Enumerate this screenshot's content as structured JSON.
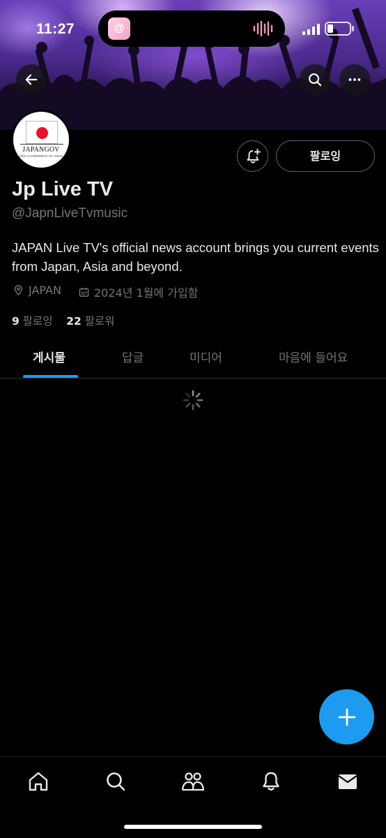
{
  "status_bar": {
    "time": "11:27",
    "island_app_glyph": "@",
    "island_app_color": "#f5a3c8",
    "battery_level": 0.25
  },
  "header": {
    "back_icon": "arrow-left-icon",
    "search_icon": "search-icon",
    "more_icon": "more-horizontal-icon"
  },
  "profile": {
    "avatar_title": "JAPANGOV",
    "avatar_subtitle": "THE GOVERNMENT OF JAPAN",
    "display_name": "Jp Live TV",
    "handle": "@JapnLiveTvmusic",
    "bio": "JAPAN Live TV's official news account brings you current events from Japan, Asia and beyond.",
    "location": "JAPAN",
    "joined": "2024년 1월에 가입함",
    "following_count": "9",
    "following_label": "팔로잉",
    "followers_count": "22",
    "followers_label": "팔로워"
  },
  "actions": {
    "notify_icon": "bell-plus-icon",
    "follow_label": "팔로잉"
  },
  "tabs": [
    {
      "label": "게시물",
      "active": true
    },
    {
      "label": "답글",
      "active": false
    },
    {
      "label": "미디어",
      "active": false
    },
    {
      "label": "마음에 들어요",
      "active": false
    }
  ],
  "fab_icon": "plus-icon",
  "bottom_nav": [
    {
      "icon": "home-icon"
    },
    {
      "icon": "search-icon"
    },
    {
      "icon": "communities-icon"
    },
    {
      "icon": "bell-icon"
    },
    {
      "icon": "mail-icon"
    }
  ],
  "colors": {
    "accent": "#1d9bf0",
    "background": "#000000",
    "muted_text": "#71767b",
    "primary_text": "#e7e9ea"
  }
}
